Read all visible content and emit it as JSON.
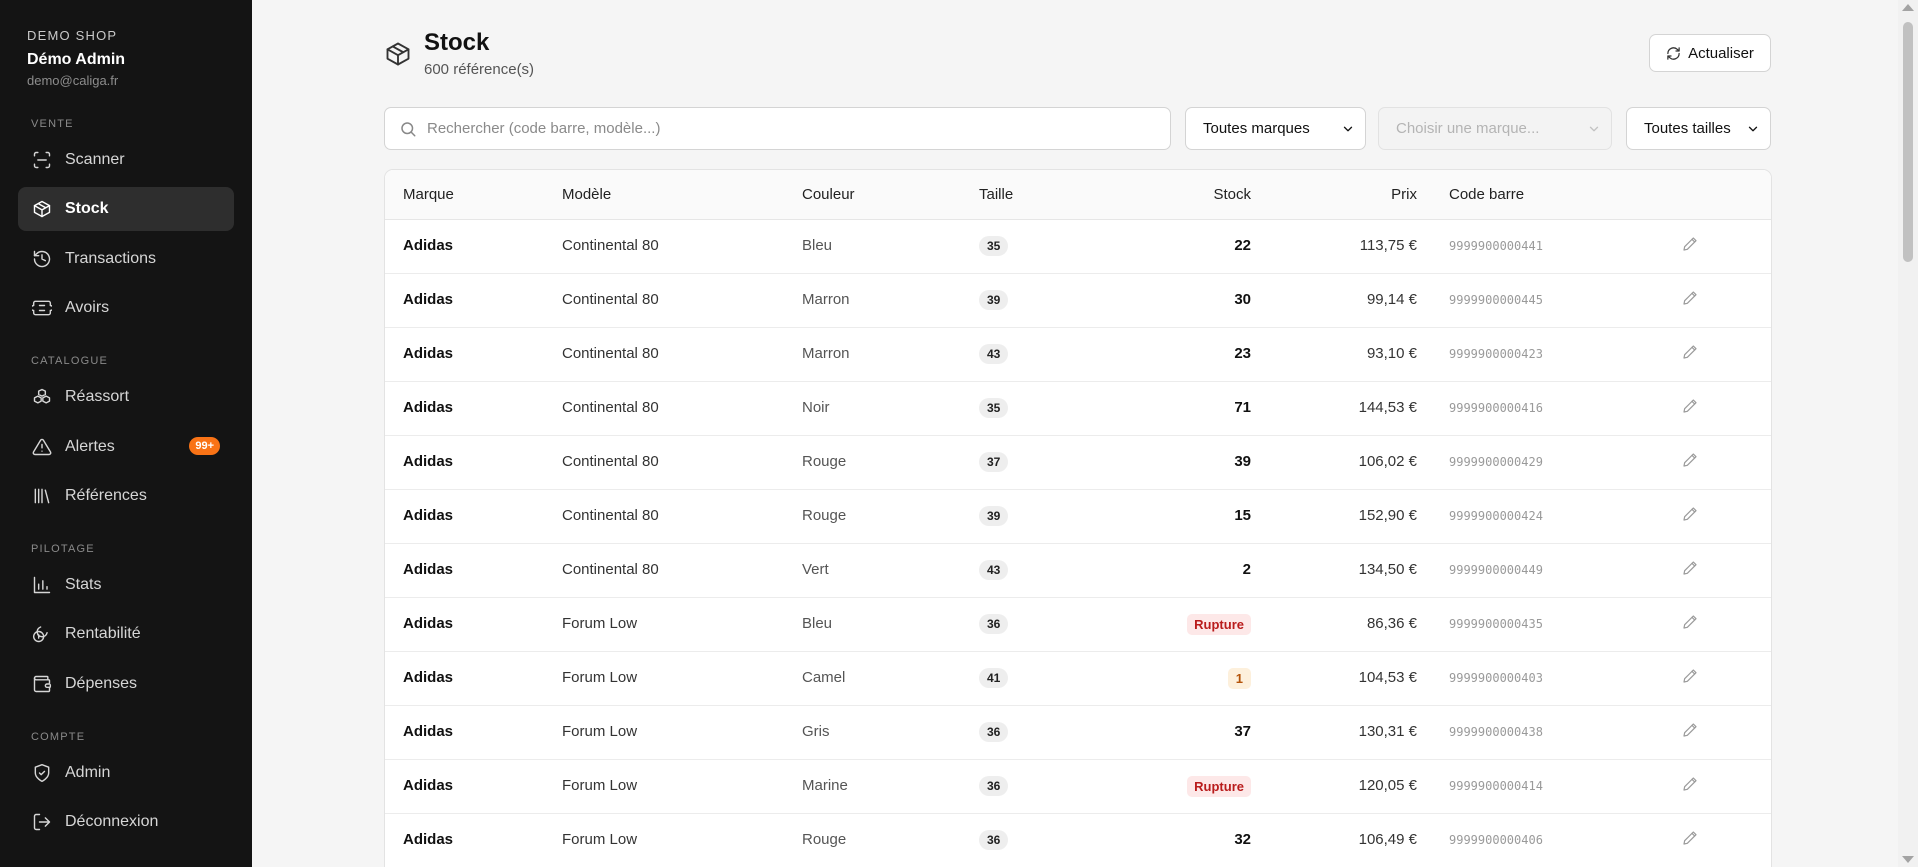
{
  "sidebar": {
    "shop_name": "DEMO SHOP",
    "user_name": "Démo Admin",
    "user_email": "demo@caliga.fr",
    "sections": [
      {
        "title": "VENTE",
        "items": [
          {
            "label": "Scanner",
            "icon": "scan-icon"
          },
          {
            "label": "Stock",
            "icon": "package-icon",
            "active": true
          },
          {
            "label": "Transactions",
            "icon": "history-icon"
          },
          {
            "label": "Avoirs",
            "icon": "ticket-icon"
          }
        ]
      },
      {
        "title": "CATALOGUE",
        "items": [
          {
            "label": "Réassort",
            "icon": "boxes-icon"
          },
          {
            "label": "Alertes",
            "icon": "alert-icon",
            "badge": "99+"
          },
          {
            "label": "Références",
            "icon": "library-icon"
          }
        ]
      },
      {
        "title": "PILOTAGE",
        "items": [
          {
            "label": "Stats",
            "icon": "chart-icon"
          },
          {
            "label": "Rentabilité",
            "icon": "coins-icon"
          },
          {
            "label": "Dépenses",
            "icon": "wallet-icon"
          }
        ]
      },
      {
        "title": "COMPTE",
        "items": [
          {
            "label": "Admin",
            "icon": "shield-icon"
          },
          {
            "label": "Déconnexion",
            "icon": "logout-icon"
          }
        ]
      }
    ]
  },
  "header": {
    "title": "Stock",
    "subtitle": "600 référence(s)",
    "refresh_label": "Actualiser"
  },
  "filters": {
    "search_placeholder": "Rechercher (code barre, modèle...)",
    "brand_select": "Toutes marques",
    "model_select": "Choisir une marque...",
    "size_select": "Toutes tailles"
  },
  "table": {
    "columns": [
      "Marque",
      "Modèle",
      "Couleur",
      "Taille",
      "Stock",
      "Prix",
      "Code barre"
    ],
    "rows": [
      {
        "brand": "Adidas",
        "model": "Continental 80",
        "color": "Bleu",
        "size": "35",
        "stock": "22",
        "stock_status": "normal",
        "price": "113,75 €",
        "barcode": "9999900000441"
      },
      {
        "brand": "Adidas",
        "model": "Continental 80",
        "color": "Marron",
        "size": "39",
        "stock": "30",
        "stock_status": "normal",
        "price": "99,14 €",
        "barcode": "9999900000445"
      },
      {
        "brand": "Adidas",
        "model": "Continental 80",
        "color": "Marron",
        "size": "43",
        "stock": "23",
        "stock_status": "normal",
        "price": "93,10 €",
        "barcode": "9999900000423"
      },
      {
        "brand": "Adidas",
        "model": "Continental 80",
        "color": "Noir",
        "size": "35",
        "stock": "71",
        "stock_status": "normal",
        "price": "144,53 €",
        "barcode": "9999900000416"
      },
      {
        "brand": "Adidas",
        "model": "Continental 80",
        "color": "Rouge",
        "size": "37",
        "stock": "39",
        "stock_status": "normal",
        "price": "106,02 €",
        "barcode": "9999900000429"
      },
      {
        "brand": "Adidas",
        "model": "Continental 80",
        "color": "Rouge",
        "size": "39",
        "stock": "15",
        "stock_status": "normal",
        "price": "152,90 €",
        "barcode": "9999900000424"
      },
      {
        "brand": "Adidas",
        "model": "Continental 80",
        "color": "Vert",
        "size": "43",
        "stock": "2",
        "stock_status": "normal",
        "price": "134,50 €",
        "barcode": "9999900000449"
      },
      {
        "brand": "Adidas",
        "model": "Forum Low",
        "color": "Bleu",
        "size": "36",
        "stock": "Rupture",
        "stock_status": "rupture",
        "price": "86,36 €",
        "barcode": "9999900000435"
      },
      {
        "brand": "Adidas",
        "model": "Forum Low",
        "color": "Camel",
        "size": "41",
        "stock": "1",
        "stock_status": "low",
        "price": "104,53 €",
        "barcode": "9999900000403"
      },
      {
        "brand": "Adidas",
        "model": "Forum Low",
        "color": "Gris",
        "size": "36",
        "stock": "37",
        "stock_status": "normal",
        "price": "130,31 €",
        "barcode": "9999900000438"
      },
      {
        "brand": "Adidas",
        "model": "Forum Low",
        "color": "Marine",
        "size": "36",
        "stock": "Rupture",
        "stock_status": "rupture",
        "price": "120,05 €",
        "barcode": "9999900000414"
      },
      {
        "brand": "Adidas",
        "model": "Forum Low",
        "color": "Rouge",
        "size": "36",
        "stock": "32",
        "stock_status": "normal",
        "price": "106,49 €",
        "barcode": "9999900000406"
      }
    ]
  },
  "colors": {
    "sidebar_bg": "#141414",
    "accent_badge": "#f97316",
    "rupture": "#b91c1c",
    "low_stock": "#b45309"
  }
}
